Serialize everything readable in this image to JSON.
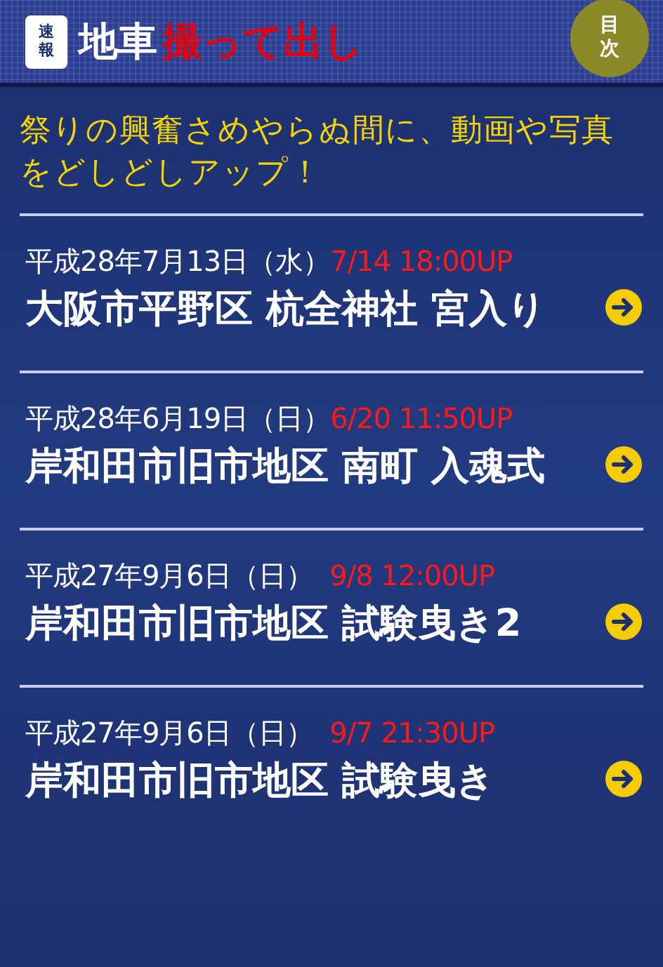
{
  "header": {
    "logo_badge_top": "速",
    "logo_badge_bottom": "報",
    "title_white": "地車",
    "title_red": "撮って出し",
    "menu_button_top": "目",
    "menu_button_bottom": "次"
  },
  "intro": "祭りの興奮さめやらぬ間に、動画や写真をどしどしアップ！",
  "items": [
    {
      "date": "平成28年7月13日（水）",
      "upload": "7/14 18:00UP",
      "title": "大阪市平野区 杭全神社 宮入り"
    },
    {
      "date": "平成28年6月19日（日）",
      "upload": "6/20 11:50UP",
      "title": "岸和田市旧市地区 南町 入魂式"
    },
    {
      "date": "平成27年9月6日（日）",
      "upload": "9/8 12:00UP",
      "title": "岸和田市旧市地区 試験曳き2"
    },
    {
      "date": "平成27年9月6日（日）",
      "upload": "9/7 21:30UP",
      "title": "岸和田市旧市地区 試験曳き"
    }
  ]
}
